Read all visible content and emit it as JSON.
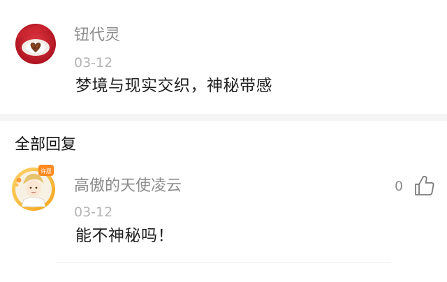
{
  "comment": {
    "username": "钮代灵",
    "date": "03-12",
    "text": "梦境与现实交织，神秘带感"
  },
  "replies_section": {
    "title": "全部回复"
  },
  "replies": [
    {
      "username": "高傲的天使凌云",
      "date": "03-12",
      "text": "能不神秘吗！",
      "like_count": "0",
      "avatar_badge": "许愿"
    }
  ],
  "colors": {
    "username": "#8c8c8c",
    "date": "#b3b3b3",
    "text": "#1f1f1f",
    "divider": "#f4f4f4",
    "avatar_red": "#c81b2a"
  },
  "icons": {
    "like": "thumbs-up-icon"
  }
}
